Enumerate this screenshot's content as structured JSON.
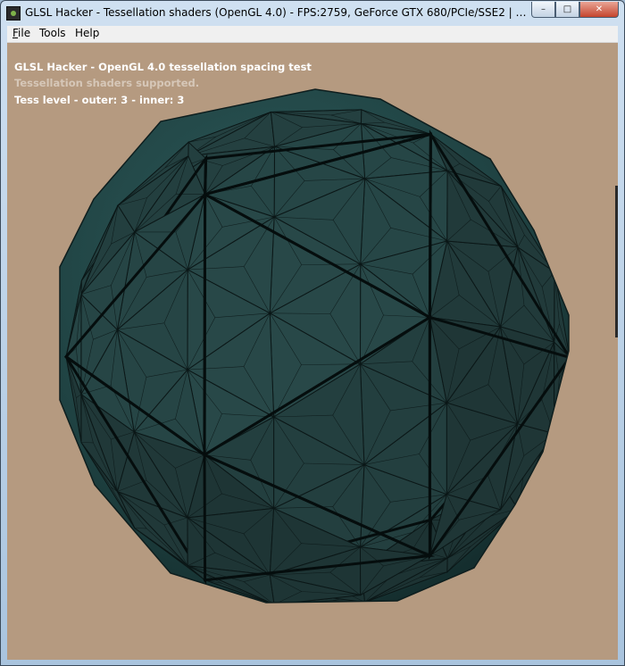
{
  "window": {
    "title": "GLSL Hacker - Tessellation shaders (OpenGL 4.0) - FPS:2759, GeForce GTX 680/PCIe/SSE2 | GLSL Hacker (Windows..."
  },
  "controls": {
    "minimize": "–",
    "maximize": "□",
    "close": "✕"
  },
  "menu": {
    "file": "File",
    "file_rest": "ile",
    "file_key": "F",
    "tools": "Tools",
    "help": "Help"
  },
  "hud": {
    "line1": "GLSL Hacker - OpenGL 4.0 tessellation spacing test",
    "line2": "Tessellation shaders supported.",
    "line3": "Tess level - outer: 3 - inner: 3"
  },
  "colors": {
    "background": "#b59a80",
    "mesh_fill": "#234747",
    "mesh_edge": "#0b1717"
  },
  "icons": {
    "app": "app-icon",
    "minimize": "minimize-icon",
    "maximize": "maximize-icon",
    "close": "close-icon"
  }
}
